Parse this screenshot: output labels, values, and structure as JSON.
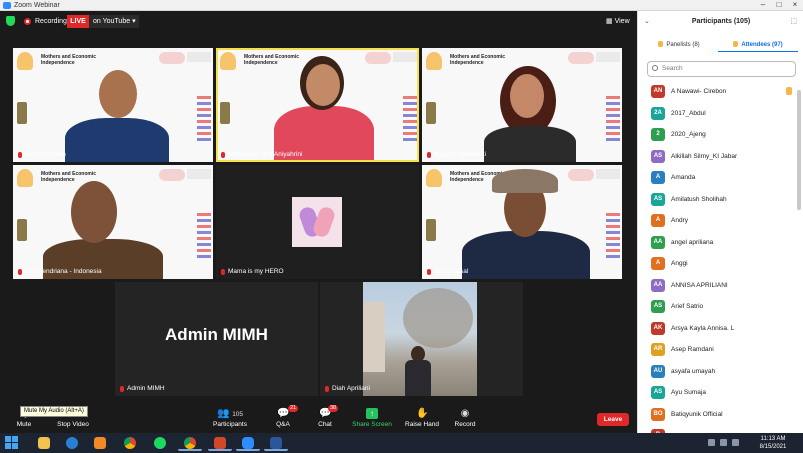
{
  "window": {
    "title": "Zoom Webinar"
  },
  "topbar": {
    "recording_label": "Recording",
    "live_label": "LIVE",
    "live_destination": "on YouTube",
    "view_label": "View"
  },
  "slide": {
    "title": "Mothers and Economic Independence"
  },
  "tiles": [
    {
      "name": "Richard Adam"
    },
    {
      "name": "Moderator: Rini Aniyahrini"
    },
    {
      "name": "Ibu Emi Widiastuti"
    },
    {
      "name": "yadi hendriana - Indonesia"
    },
    {
      "name": "Mama is my HERO"
    },
    {
      "name": "Bang Faisal"
    },
    {
      "name": "Admin MIMH",
      "display_text": "Admin MIMH"
    },
    {
      "name": "Diah Apriliani"
    }
  ],
  "toolbar": {
    "mute": "Mute",
    "stop_video": "Stop Video",
    "participants": "Participants",
    "participant_count": "105",
    "qa": "Q&A",
    "qa_badge": "21",
    "chat": "Chat",
    "chat_badge": "38",
    "share_screen": "Share Screen",
    "raise_hand": "Raise Hand",
    "record": "Record",
    "leave": "Leave",
    "tooltip": "Mute My Audio (Alt+A)"
  },
  "panel": {
    "title": "Participants (105)",
    "tab_panelists": "Panelists (8)",
    "tab_attendees": "Attendees (97)",
    "search_placeholder": "Search",
    "participants": [
      {
        "initials": "AN",
        "name": "A Nawawi- Cirebon",
        "color": "#c0392b",
        "hand": true
      },
      {
        "initials": "2A",
        "name": "2017_Abdul",
        "color": "#1aa59a",
        "hand": false
      },
      {
        "initials": "2",
        "name": "2020_Ajeng",
        "color": "#2e9e4f",
        "hand": false
      },
      {
        "initials": "AS",
        "name": "Alkillah Silmy_KI Jabar",
        "color": "#8e6bc4",
        "hand": false
      },
      {
        "initials": "A",
        "name": "Amanda",
        "color": "#2a7fc1",
        "hand": false
      },
      {
        "initials": "AS",
        "name": "Amilatush Sholihah",
        "color": "#1aa59a",
        "hand": false
      },
      {
        "initials": "A",
        "name": "Andry",
        "color": "#e07020",
        "hand": false
      },
      {
        "initials": "AA",
        "name": "angel apriliana",
        "color": "#2e9e4f",
        "hand": false
      },
      {
        "initials": "A",
        "name": "Anggi",
        "color": "#e07020",
        "hand": false
      },
      {
        "initials": "AA",
        "name": "ANNISA APRILIANI",
        "color": "#8e6bc4",
        "hand": false
      },
      {
        "initials": "AS",
        "name": "Arief Satrio",
        "color": "#2e9e4f",
        "hand": false
      },
      {
        "initials": "AK",
        "name": "Arsya Kayla Annisa. L",
        "color": "#c0392b",
        "hand": false
      },
      {
        "initials": "AR",
        "name": "Asep Ramdani",
        "color": "#e0a020",
        "hand": false
      },
      {
        "initials": "AU",
        "name": "asyafa umayah",
        "color": "#2a7fc1",
        "hand": false
      },
      {
        "initials": "AS",
        "name": "Ayu Sumaja",
        "color": "#1aa59a",
        "hand": false
      },
      {
        "initials": "BO",
        "name": "Batiqyunik Official",
        "color": "#e07020",
        "hand": false
      },
      {
        "initials": "B",
        "name": "",
        "color": "#c0392b",
        "hand": false
      }
    ]
  },
  "taskbar": {
    "time": "11:13 AM",
    "date": "8/15/2021"
  }
}
